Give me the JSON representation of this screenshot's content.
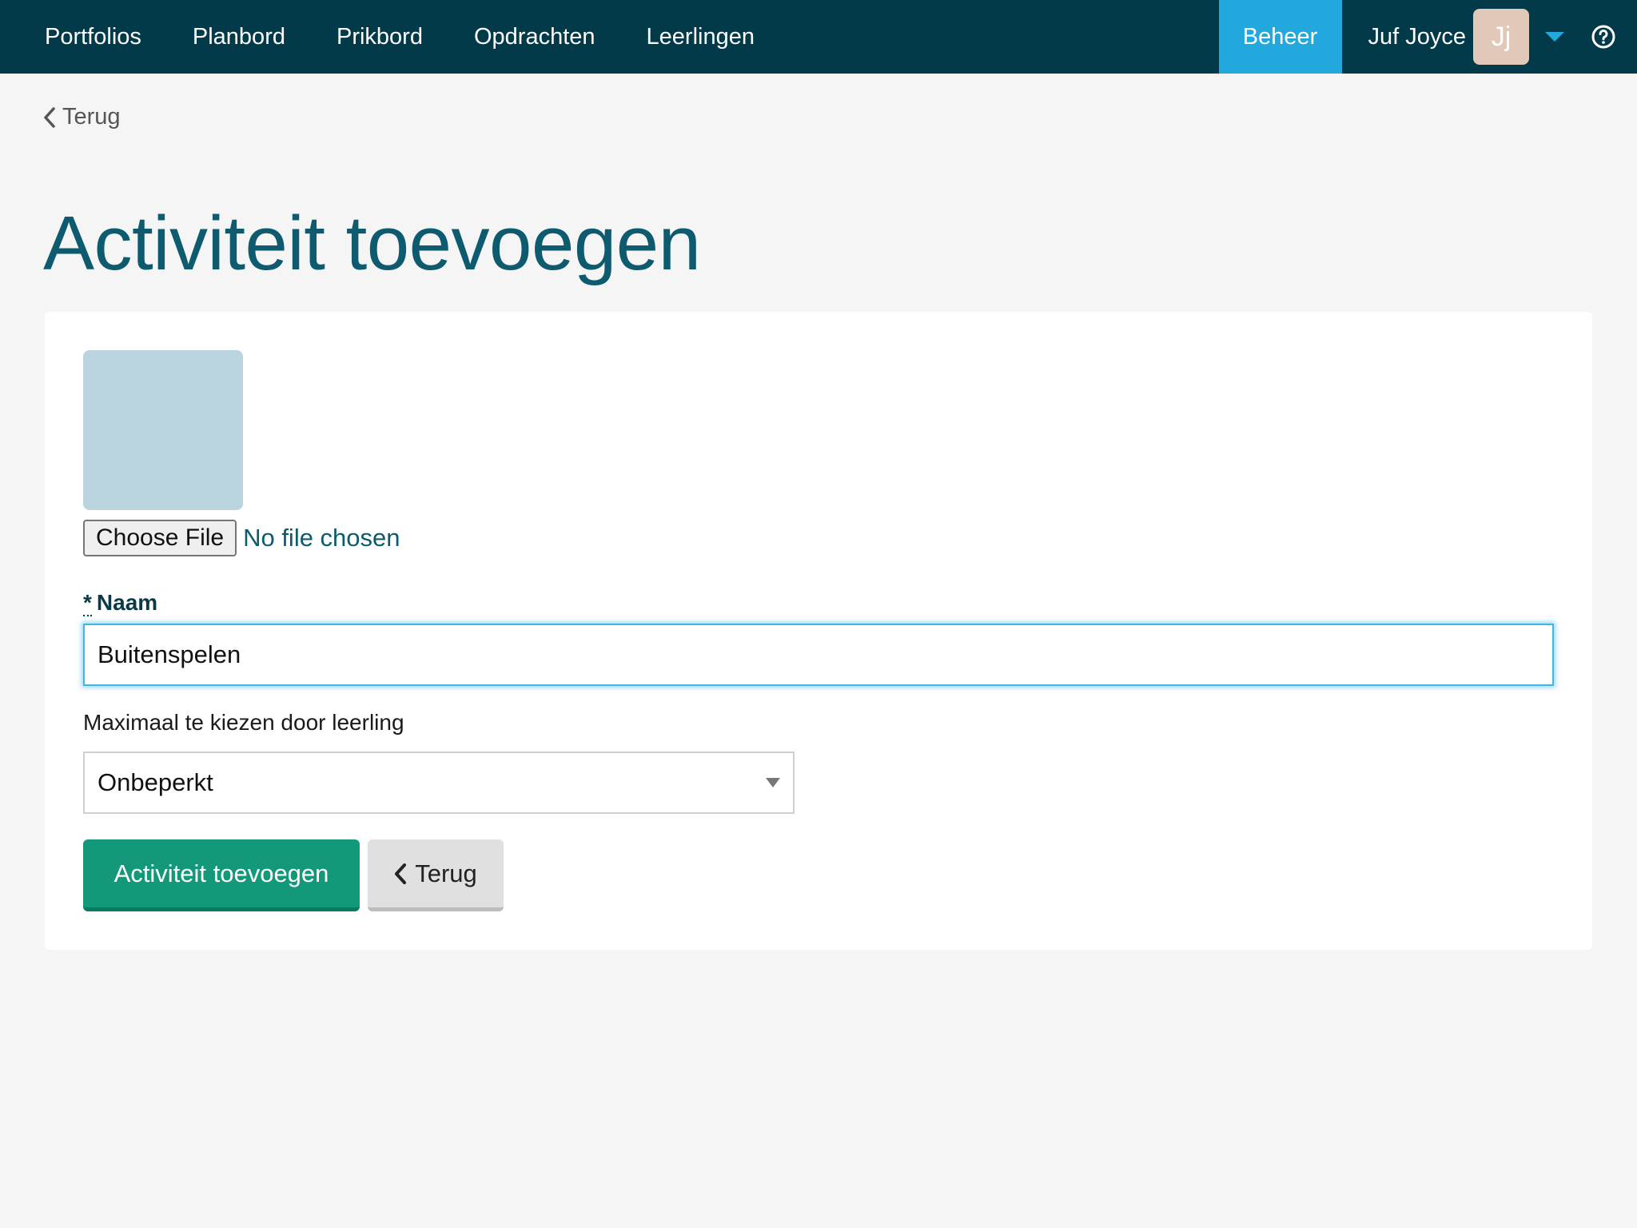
{
  "nav": {
    "items": [
      {
        "label": "Portfolios"
      },
      {
        "label": "Planbord"
      },
      {
        "label": "Prikbord"
      },
      {
        "label": "Opdrachten"
      },
      {
        "label": "Leerlingen"
      }
    ],
    "admin_label": "Beheer",
    "user_name": "Juf Joyce",
    "avatar_initials": "Jj",
    "help_icon": "question-circle-icon",
    "accent_color": "#22a8dc",
    "bar_color": "#023a4a"
  },
  "back_link": {
    "label": "Terug",
    "icon": "chevron-left-icon"
  },
  "page": {
    "title": "Activiteit toevoegen"
  },
  "form": {
    "file": {
      "button_label": "Choose File",
      "status_text": "No file chosen"
    },
    "naam": {
      "required_marker": "*",
      "label": "Naam",
      "value": "Buitenspelen"
    },
    "max": {
      "label": "Maximaal te kiezen door leerling",
      "selected": "Onbeperkt"
    },
    "submit_label": "Activiteit toevoegen",
    "back_label": "Terug",
    "submit_color": "#13997a"
  }
}
